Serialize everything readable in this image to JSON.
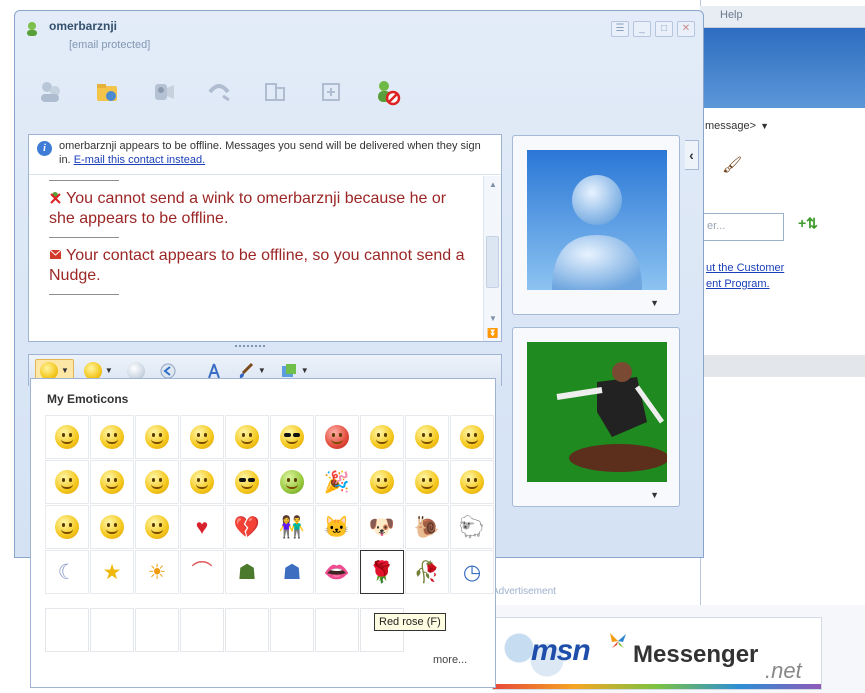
{
  "background": {
    "menu_label": "Help",
    "status_text": "message>",
    "search_placeholder": "er...",
    "link1": "ut the Customer",
    "link2": "ent Program.",
    "footer_label": "Advertisement"
  },
  "window": {
    "contact_name": "omerbarznji",
    "contact_email": "[email protected]"
  },
  "toolbar": {
    "icons": [
      "invite-icon",
      "send-files-icon",
      "video-icon",
      "call-icon",
      "activities-icon",
      "games-icon",
      "block-icon"
    ]
  },
  "infobar": {
    "text": "omerbarznji appears to be offline. Messages you send will be delivered when they sign in.",
    "link": "E-mail this contact instead."
  },
  "history": {
    "msg1": "You cannot send a wink to omerbarznji because he or she appears to be offline.",
    "msg2": "Your contact appears to be offline, so you cannot send a Nudge."
  },
  "emoticons": {
    "title": "My Emoticons",
    "more": "more...",
    "tooltip": "Red rose (F)"
  },
  "logo": {
    "msn": "msn",
    "messenger": "Messenger",
    "net": ".net"
  },
  "colors": {
    "system_message": "#9c2626",
    "link": "#1a3fb8",
    "window_bg": "#d4e2f4"
  }
}
